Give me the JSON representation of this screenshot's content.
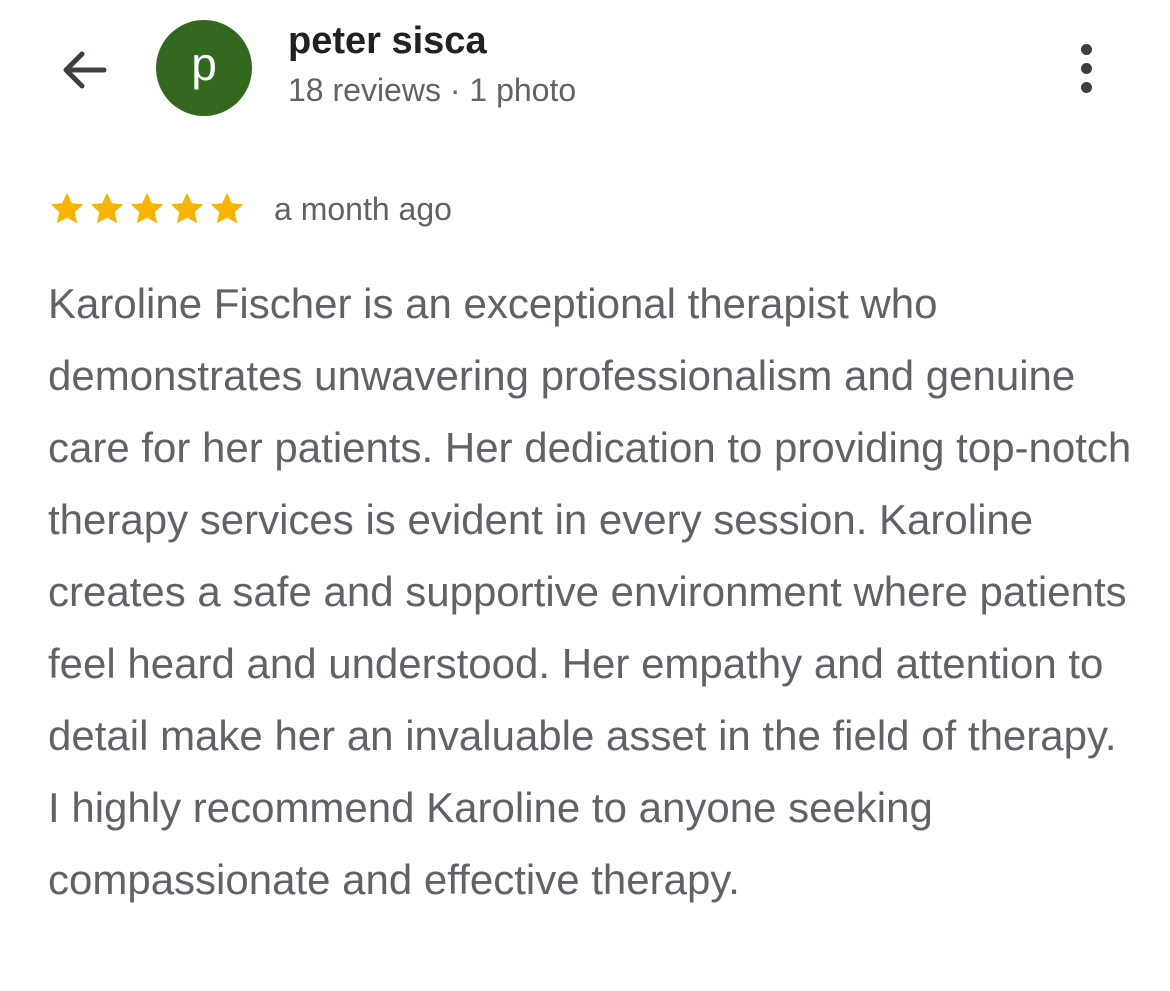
{
  "header": {
    "back_icon": "arrow-left-icon",
    "avatar_letter": "p",
    "avatar_color": "#33691e",
    "reviewer_name": "peter sisca",
    "reviewer_meta": "18 reviews · 1 photo",
    "more_icon": "more-vertical-icon"
  },
  "review": {
    "rating": 5,
    "rating_max": 5,
    "star_color": "#f4b400",
    "date": "a month ago",
    "text": "Karoline Fischer is an exceptional therapist who demonstrates unwavering professionalism and genuine care for her patients. Her dedication to providing top-notch therapy services is evident in every session. Karoline creates a safe and supportive environment where patients feel heard and understood. Her empathy and attention to detail make her an invaluable asset in the field of therapy. I highly recommend Karoline to anyone seeking compassionate and effective therapy."
  }
}
